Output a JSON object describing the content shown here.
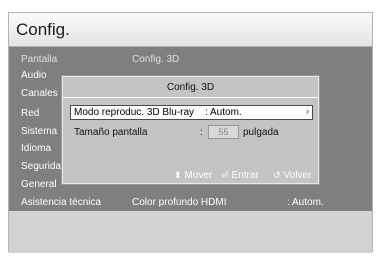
{
  "header": {
    "title": "Config."
  },
  "sidebar": {
    "items": [
      {
        "label": "Pantalla"
      },
      {
        "label": "Audio"
      },
      {
        "label": "Canales"
      },
      {
        "label": "Red"
      },
      {
        "label": "Sistema"
      },
      {
        "label": "Idioma"
      },
      {
        "label": "Seguridad"
      },
      {
        "label": "General"
      },
      {
        "label": "Asistencia técnica"
      }
    ]
  },
  "main": {
    "top_value": "Config. 3D",
    "bottom_setting": {
      "label": "Color profundo HDMI",
      "value": ": Autom."
    }
  },
  "dialog": {
    "title": "Config. 3D",
    "option": {
      "label": "Modo reproduc. 3D Blu-ray",
      "value": ": Autom."
    },
    "size": {
      "label": "Tamaño pantalla",
      "colon": ":",
      "value": "55",
      "unit": "pulgada"
    },
    "footer": {
      "move": "Mover",
      "enter": "Entrar",
      "back": "Volver"
    }
  },
  "icons": {
    "move": "up-down-arrow-icon",
    "enter": "enter-icon",
    "back": "return-icon",
    "arrow": "chevron-right-icon"
  }
}
